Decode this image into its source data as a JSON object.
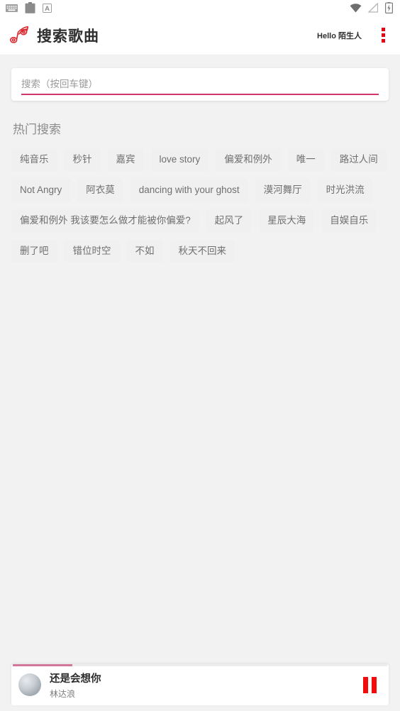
{
  "status_bar": {
    "left_icons": [
      "keyboard-icon",
      "clipboard-icon",
      "ime-a-icon"
    ],
    "right_icons": [
      "wifi-icon",
      "signal-off-icon",
      "battery-charging-icon"
    ]
  },
  "header": {
    "logo_icon": "music-note-icon",
    "title": "搜索歌曲",
    "greeting": "Hello 陌生人",
    "menu_icon": "more-vertical-icon",
    "accent_color": "#e60012"
  },
  "search": {
    "value": "",
    "placeholder": "搜索（按回车键）",
    "underline_color": "#d2366a"
  },
  "hot_search": {
    "title": "热门搜索",
    "tags": [
      "纯音乐",
      "秒针",
      "嘉宾",
      "love story",
      "偏爱和例外",
      "唯一",
      "路过人间",
      "Not Angry",
      "阿衣莫",
      "dancing with your ghost",
      "漠河舞厅",
      "时光洪流",
      "偏爱和例外 我该要怎么做才能被你偏爱?",
      "起风了",
      "星辰大海",
      "自娱自乐",
      "删了吧",
      "错位时空",
      "不如",
      "秋天不回来"
    ]
  },
  "player": {
    "album_art": "album-art-placeholder",
    "track_title": "还是会想你",
    "track_artist": "林达浪",
    "control_icon": "pause-icon",
    "control_color": "#f40c0c",
    "progress_percent": 16,
    "progress_color": "#d2779a"
  }
}
